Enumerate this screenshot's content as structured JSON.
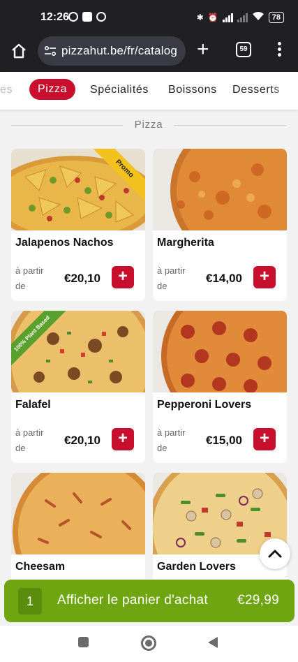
{
  "status_bar": {
    "time": "12:26",
    "battery": "78"
  },
  "browser": {
    "url": "pizzahut.be/fr/catalog",
    "tab_count": "59",
    "new_tab": "+"
  },
  "categories": [
    {
      "label": "es",
      "state": "partial"
    },
    {
      "label": "Pizza",
      "state": "active"
    },
    {
      "label": "Spécialités",
      "state": "normal"
    },
    {
      "label": "Boissons",
      "state": "normal"
    },
    {
      "label": "Desserts",
      "state": "normal"
    }
  ],
  "section_title": "Pizza",
  "products": [
    {
      "name": "Jalapenos Nachos",
      "from_label": "à partir de",
      "price": "€20,10",
      "badge": "Promo",
      "add": "+"
    },
    {
      "name": "Margherita",
      "from_label": "à partir de",
      "price": "€14,00",
      "add": "+"
    },
    {
      "name": "Falafel",
      "from_label": "à partir de",
      "price": "€20,10",
      "badge": "100% Plant Based",
      "add": "+"
    },
    {
      "name": "Pepperoni Lovers",
      "from_label": "à partir de",
      "price": "€15,00",
      "add": "+"
    },
    {
      "name": "Cheesam"
    },
    {
      "name": "Garden Lovers"
    }
  ],
  "cart": {
    "count": "1",
    "label": "Afficher le panier d'achat",
    "total": "€29,99"
  },
  "colors": {
    "brand_red": "#c8102e",
    "cart_green": "#6ea510",
    "chrome_dark": "#1f1f24"
  },
  "icons": {
    "home": "home-icon",
    "site_settings": "tune-icon",
    "tabs": "tabs-icon",
    "menu": "kebab-menu-icon",
    "scroll_up": "chevron-up-icon"
  }
}
